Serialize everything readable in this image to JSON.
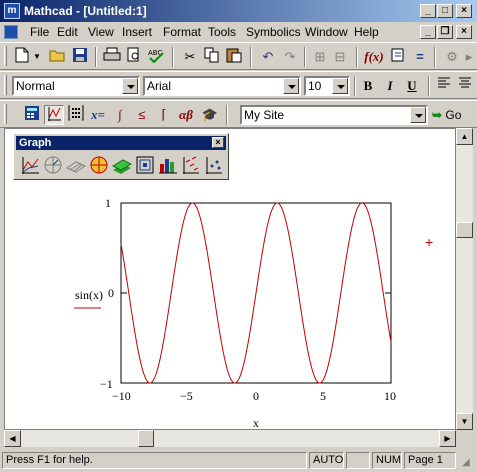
{
  "window": {
    "title": "Mathcad - [Untitled:1]",
    "app_icon": "m"
  },
  "menu": [
    "File",
    "Edit",
    "View",
    "Insert",
    "Format",
    "Tools",
    "Symbolics",
    "Window",
    "Help"
  ],
  "format_bar": {
    "style": "Normal",
    "font": "Arial",
    "size": "10"
  },
  "math_bar": {
    "site": "My Site",
    "go_label": "Go"
  },
  "palette": {
    "title": "Graph"
  },
  "plot": {
    "y_label": "sin(x)",
    "x_label": "x",
    "y_ticks": [
      "1",
      "0",
      "−1"
    ],
    "x_ticks": [
      "−10",
      "−5",
      "0",
      "5",
      "10"
    ],
    "crosshair": "+"
  },
  "chart_data": {
    "type": "line",
    "series": [
      {
        "name": "sin(x)",
        "function": "sin(x)",
        "color": "#c00000"
      }
    ],
    "xlabel": "x",
    "ylabel": "sin(x)",
    "xlim": [
      -10,
      10
    ],
    "ylim": [
      -1,
      1
    ],
    "x_ticks": [
      -10,
      -5,
      0,
      5,
      10
    ],
    "y_ticks": [
      -1,
      0,
      1
    ]
  },
  "status": {
    "help": "Press F1 for help.",
    "mode": "AUTO",
    "num": "NUM",
    "page": "Page 1"
  },
  "colors": {
    "title_bar": "#0a246a",
    "trace": "#c00000",
    "face": "#d4d0c8"
  }
}
